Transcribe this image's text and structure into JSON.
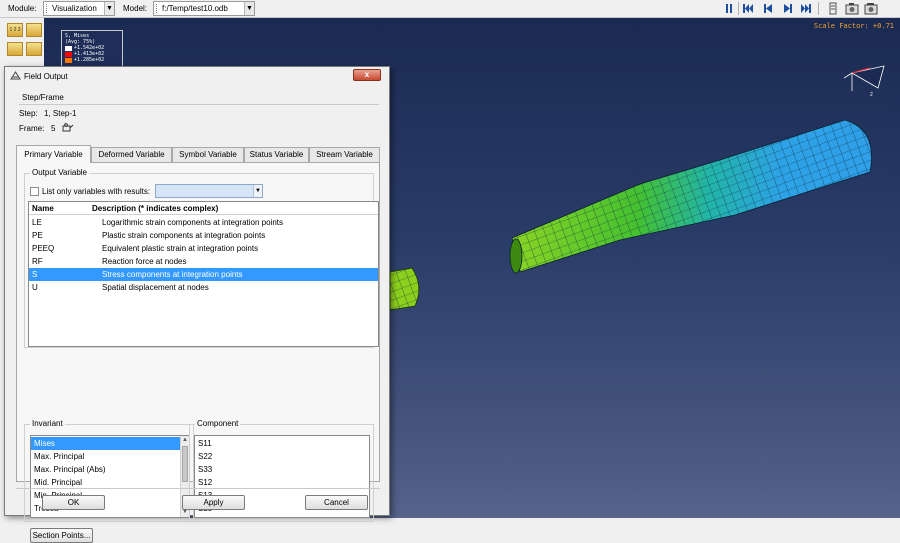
{
  "toolbar": {
    "module_label": "Module:",
    "module_value": "Visualization",
    "model_label": "Model:",
    "model_value": "f:/Temp/test10.odb"
  },
  "viewport": {
    "scale_factor": "Scale Factor: +0.71",
    "legend": {
      "title": "S, Mises",
      "subtitle": "(Avg: 75%)",
      "entries": [
        "+1.542e+02",
        "+1.413e+02",
        "+1.285e+02"
      ],
      "colors": [
        "#ffffff",
        "#ff0000",
        "#ff7a00"
      ]
    },
    "triad_label": "2"
  },
  "dialog": {
    "title": "Field Output",
    "close_label": "x",
    "step_frame_heading": "Step/Frame",
    "step_label": "Step:",
    "step_value": "1, Step-1",
    "frame_label": "Frame:",
    "frame_value": "5",
    "tabs": [
      "Primary Variable",
      "Deformed Variable",
      "Symbol Variable",
      "Status Variable",
      "Stream Variable"
    ],
    "active_tab": 0,
    "output_variable_heading": "Output Variable",
    "list_only_label": "List only variables with results:",
    "list_only_checked": false,
    "table": {
      "col_name": "Name",
      "col_desc": "Description (* indicates complex)",
      "rows": [
        {
          "name": "LE",
          "desc": "Logarithmic strain components at integration points"
        },
        {
          "name": "PE",
          "desc": "Plastic strain components at integration points"
        },
        {
          "name": "PEEQ",
          "desc": "Equivalent plastic strain at integration points"
        },
        {
          "name": "RF",
          "desc": "Reaction force at nodes"
        },
        {
          "name": "S",
          "desc": "Stress components at integration points"
        },
        {
          "name": "U",
          "desc": "Spatial displacement at nodes"
        }
      ],
      "selected": 4
    },
    "invariant_heading": "Invariant",
    "invariants": [
      "Mises",
      "Max. Principal",
      "Max. Principal (Abs)",
      "Mid. Principal",
      "Min. Principal",
      "Tresca"
    ],
    "invariant_selected": 0,
    "component_heading": "Component",
    "components": [
      "S11",
      "S22",
      "S33",
      "S12",
      "S13",
      "S23"
    ],
    "section_points_label": "Section Points...",
    "ok_label": "OK",
    "apply_label": "Apply",
    "cancel_label": "Cancel"
  },
  "colors": {
    "selection": "#3399ff",
    "scale_factor_text": "#f0a030",
    "mesh_blue": "#2aa0e8",
    "mesh_green": "#66cc22"
  }
}
